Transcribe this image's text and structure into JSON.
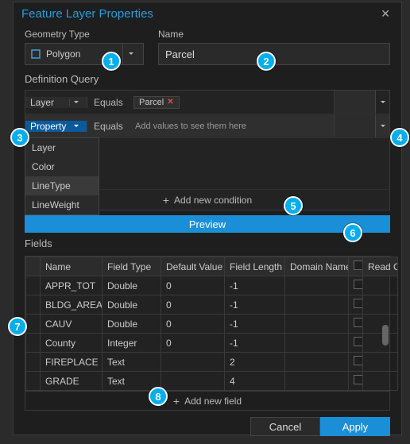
{
  "dialog": {
    "title": "Feature Layer Properties",
    "close_glyph": "✕"
  },
  "geometry": {
    "label": "Geometry Type",
    "value": "Polygon"
  },
  "name": {
    "label": "Name",
    "value": "Parcel"
  },
  "defq": {
    "header": "Definition Query",
    "rows": [
      {
        "field": "Layer",
        "op": "Equals",
        "chip": "Parcel",
        "chip_close": "✕"
      },
      {
        "field": "Property",
        "op": "Equals",
        "hint": "Add values to see them here"
      }
    ],
    "dropdown_items": [
      "Layer",
      "Color",
      "LineType",
      "LineWeight"
    ],
    "add_label": "Add new condition",
    "preview": "Preview"
  },
  "fields": {
    "header": "Fields",
    "columns": [
      "",
      "Name",
      "Field Type",
      "Default Value",
      "Field Length",
      "Domain Name",
      "",
      "Read Only"
    ],
    "rows": [
      {
        "name": "APPR_TOT",
        "type": "Double",
        "def": "0",
        "len": "-1"
      },
      {
        "name": "BLDG_AREA",
        "type": "Double",
        "def": "0",
        "len": "-1"
      },
      {
        "name": "CAUV",
        "type": "Double",
        "def": "0",
        "len": "-1"
      },
      {
        "name": "County",
        "type": "Integer",
        "def": "0",
        "len": "-1"
      },
      {
        "name": "FIREPLACE",
        "type": "Text",
        "def": "",
        "len": "2"
      },
      {
        "name": "GRADE",
        "type": "Text",
        "def": "",
        "len": "4"
      }
    ],
    "add_label": "Add new field"
  },
  "footer": {
    "cancel": "Cancel",
    "apply": "Apply"
  },
  "callouts": {
    "1": "1",
    "2": "2",
    "3": "3",
    "4": "4",
    "5": "5",
    "6": "6",
    "7": "7",
    "8": "8"
  }
}
